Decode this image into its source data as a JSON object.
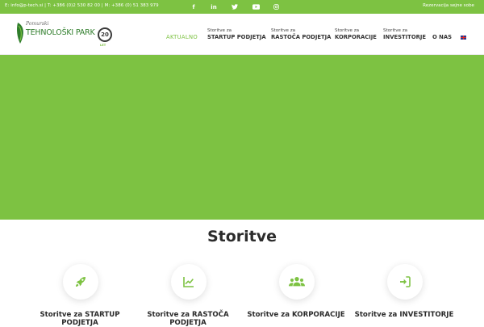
{
  "topbar": {
    "contact": "E: info@p-tech.si | T: +386 (0)2 530 82 00 | M: +386 (0) 51 383 979",
    "reservation": "Rezervacija sejne sobe",
    "social": [
      {
        "name": "facebook-icon",
        "glyph": "f"
      },
      {
        "name": "linkedin-icon",
        "glyph": "in"
      },
      {
        "name": "twitter-icon",
        "glyph": "🐦"
      },
      {
        "name": "youtube-icon",
        "glyph": "▶"
      },
      {
        "name": "instagram-icon",
        "glyph": "◎"
      }
    ]
  },
  "logo": {
    "small": "Pomurski",
    "name": "TEHNOLOŠKI PARK",
    "badge": "20",
    "badge_sub": "LET"
  },
  "nav": {
    "aktualno": "AKTUALNO",
    "items": [
      {
        "small": "Storitve za",
        "big": "STARTUP PODJETJA"
      },
      {
        "small": "Storitve za",
        "big": "RASTOČA PODJETJA"
      },
      {
        "small": "Storitve za",
        "big": "KORPORACIJE"
      },
      {
        "small": "Storitve za",
        "big": "INVESTITORJE"
      }
    ],
    "onas": "O NAS",
    "language_icon": "uk-flag-icon"
  },
  "section": {
    "title": "Storitve"
  },
  "services": [
    {
      "label": "Storitve za STARTUP PODJETJA",
      "icon": "rocket-icon"
    },
    {
      "label": "Storitve za RASTOČA PODJETJA",
      "icon": "chart-line-icon"
    },
    {
      "label": "Storitve za KORPORACIJE",
      "icon": "users-icon"
    },
    {
      "label": "Storitve za INVESTITORJE",
      "icon": "sign-in-icon"
    }
  ],
  "colors": {
    "accent": "#7dc242",
    "logo_green": "#2f7d2b",
    "text": "#2b2b2b"
  }
}
